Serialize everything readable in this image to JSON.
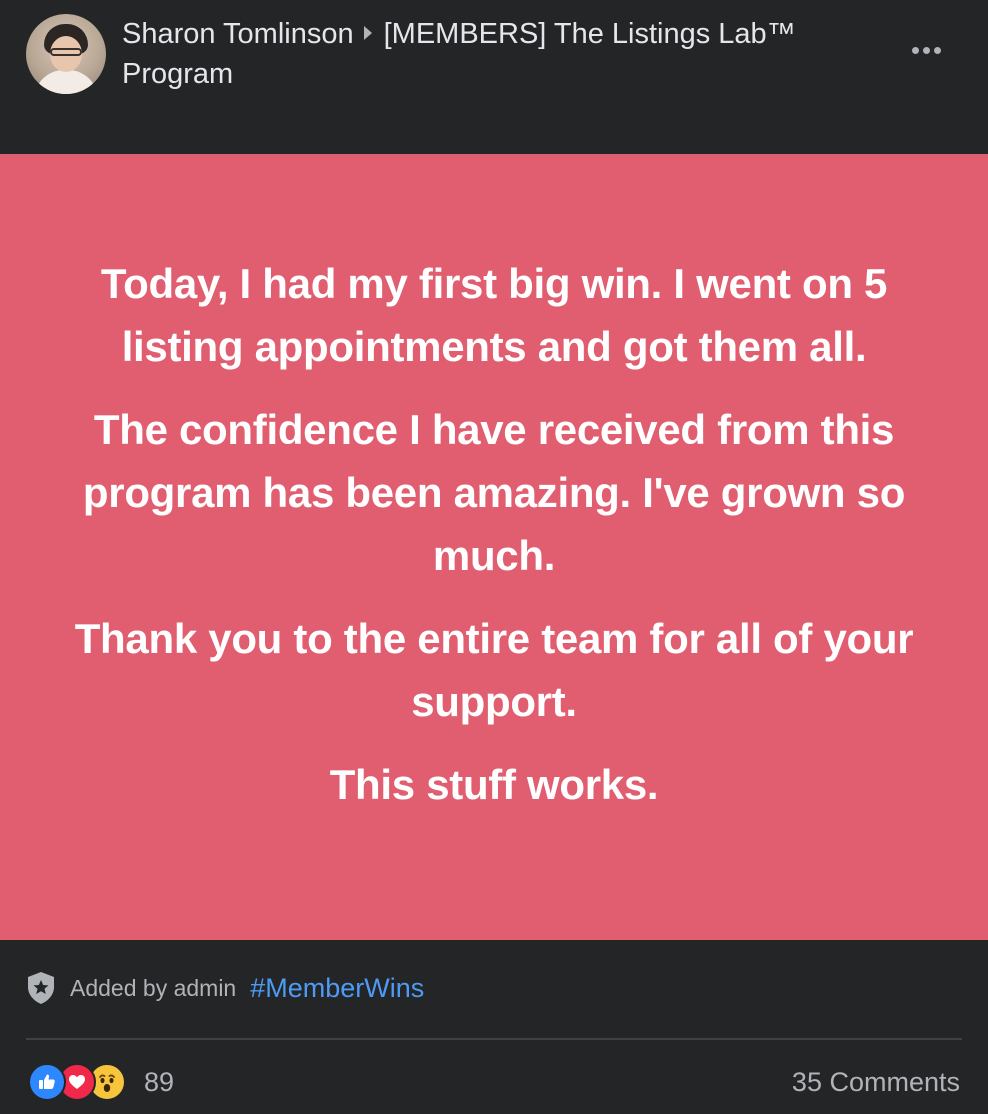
{
  "header": {
    "author": "Sharon Tomlinson",
    "group": "[MEMBERS] The Listings Lab™ Program"
  },
  "post": {
    "paragraphs": [
      "Today, I had my first big win. I went on 5 listing appointments and got them all.",
      "The confidence I have received from this program has been amazing. I've grown so much.",
      "Thank you to the entire team for all of your support.",
      "This stuff works."
    ],
    "background_color": "#e05e6f"
  },
  "footer": {
    "added_by": "Added by admin",
    "hashtag": "#MemberWins",
    "reaction_count": "89",
    "comments": "35 Comments"
  },
  "icons": {
    "avatar": "profile-photo",
    "separator": "triangle-right-icon",
    "more": "more-options-icon",
    "badge": "admin-shield-star-icon",
    "reactions": [
      "like-icon",
      "love-icon",
      "wow-icon"
    ]
  }
}
